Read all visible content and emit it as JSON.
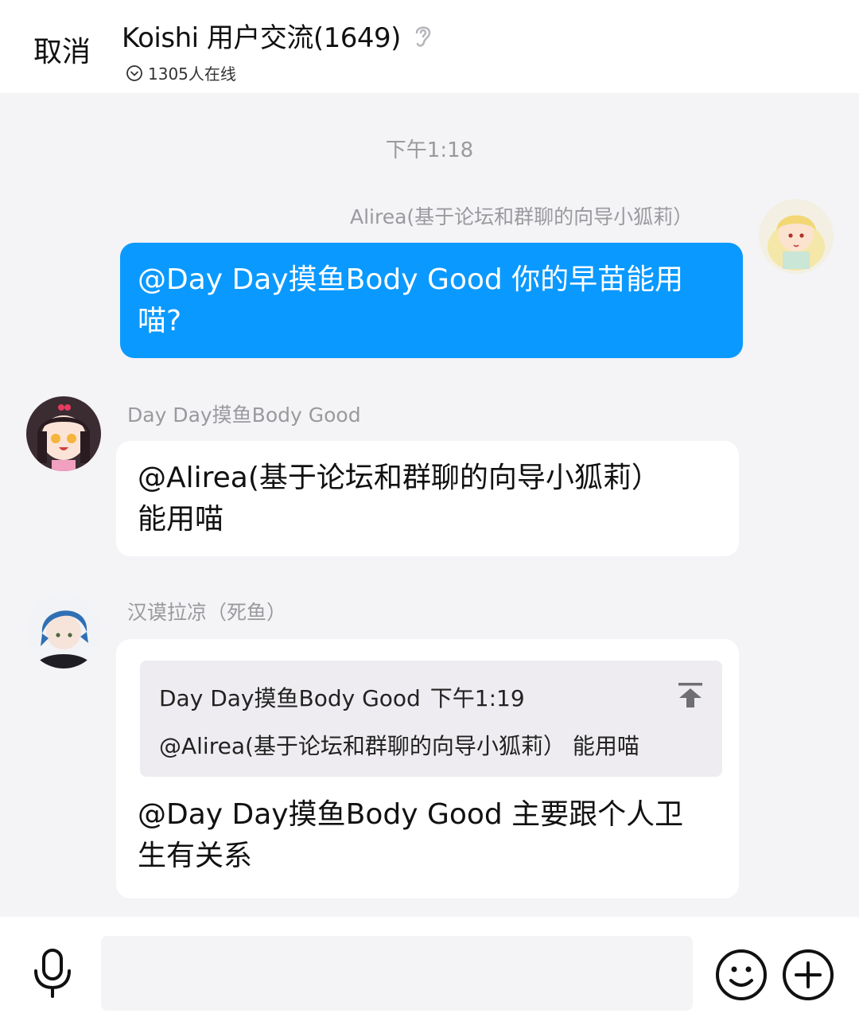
{
  "header": {
    "cancel_label": "取消",
    "title": "Koishi 用户交流(1649)",
    "online_text": "1305人在线"
  },
  "timestamp": "下午1:18",
  "messages": [
    {
      "sender": "Alirea(基于论坛和群聊的向导小狐莉）",
      "lines": [
        "@Day Day摸鱼Body Good 你的早苗能用",
        "喵?"
      ],
      "direction": "outgoing"
    },
    {
      "sender": "Day Day摸鱼Body Good",
      "lines": [
        "@Alirea(基于论坛和群聊的向导小狐莉）",
        "能用喵"
      ],
      "direction": "incoming"
    },
    {
      "sender": "汉谟拉凉（死鱼）",
      "quote": {
        "author": "Day Day摸鱼Body Good",
        "time": "下午1:19",
        "text": "@Alirea(基于论坛和群聊的向导小狐莉） 能用喵"
      },
      "lines": [
        "@Day Day摸鱼Body Good 主要跟个人卫",
        "生有关系"
      ],
      "direction": "incoming"
    }
  ],
  "input_bar": {
    "input_value": "",
    "icons": [
      "microphone-icon",
      "emoji-icon",
      "plus-icon"
    ]
  },
  "colors": {
    "outgoing_bubble": "#0a99ff",
    "incoming_bubble": "#ffffff",
    "background": "#f4f3f6"
  }
}
